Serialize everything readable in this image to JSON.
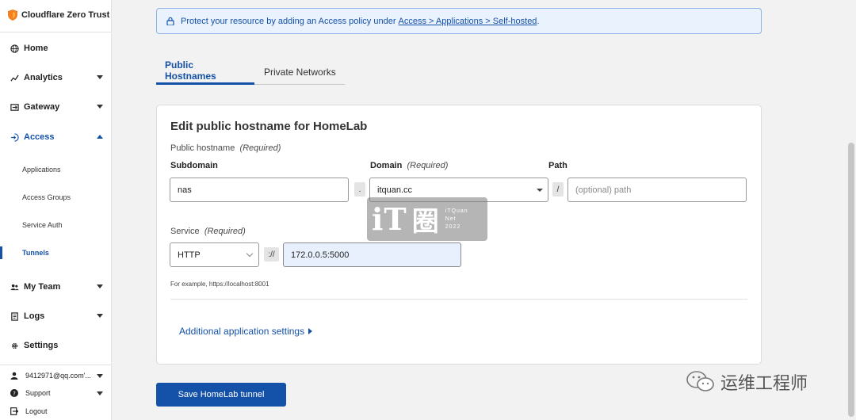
{
  "sidebar": {
    "brand": "Cloudflare Zero Trust",
    "nav": [
      {
        "label": "Home"
      },
      {
        "label": "Analytics"
      },
      {
        "label": "Gateway"
      },
      {
        "label": "Access"
      }
    ],
    "access_subitems": [
      {
        "label": "Applications"
      },
      {
        "label": "Access Groups"
      },
      {
        "label": "Service Auth"
      },
      {
        "label": "Tunnels"
      }
    ],
    "nav2": [
      {
        "label": "My Team"
      },
      {
        "label": "Logs"
      },
      {
        "label": "Settings"
      }
    ],
    "footer": {
      "account": "9412971@qq.com'...",
      "support": "Support",
      "logout": "Logout"
    }
  },
  "notice": {
    "text": "Protect your resource by adding an Access policy under",
    "link": "Access > Applications > Self-hosted",
    "suffix": "."
  },
  "tabs": [
    {
      "label": "Public Hostnames",
      "active": true
    },
    {
      "label": "Private Networks",
      "active": false
    }
  ],
  "form": {
    "title": "Edit public hostname for HomeLab",
    "public_hostname_label": "Public hostname",
    "required": "(Required)",
    "subdomain_label": "Subdomain",
    "subdomain_value": "nas",
    "dot_sep": ".",
    "domain_label": "Domain",
    "domain_value": "itquan.cc",
    "slash_sep": "/",
    "path_label": "Path",
    "path_placeholder": "(optional) path",
    "service_label": "Service",
    "service_type": "HTTP",
    "scheme_sep": "://",
    "service_url": "172.0.0.5:5000",
    "hint": "For example, https://localhost:8001",
    "advanced_link": "Additional application settings"
  },
  "save_button": "Save HomeLab tunnel",
  "watermark": {
    "logo_a": "iT",
    "logo_b": "圈",
    "line1": "iTQuan",
    "line2": "Net",
    "line3": "2022",
    "wechat_name": "运维工程师"
  },
  "colors": {
    "accent": "#1451a8",
    "brand_orange": "#f38020"
  }
}
